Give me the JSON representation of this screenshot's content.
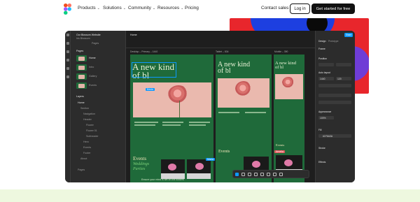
{
  "nav": {
    "links": [
      {
        "label": "Products",
        "has_menu": true
      },
      {
        "label": "Solutions",
        "has_menu": true
      },
      {
        "label": "Community",
        "has_menu": true
      },
      {
        "label": "Resources",
        "has_menu": true
      },
      {
        "label": "Pricing",
        "has_menu": false
      }
    ],
    "contact": "Contact sales",
    "login": "Log in",
    "cta": "Get started for free"
  },
  "editor": {
    "file_name": "Our Blossom Website",
    "team": "Iris Blossom",
    "pages_heading": "Pages",
    "pages": [
      "Home",
      "Intro",
      "Gallery",
      "Events",
      "Contact"
    ],
    "layers_heading": "Layers",
    "layers": [
      "Home",
      "Section",
      "Navigation",
      "Header",
      "Flower",
      "Flower 01",
      "Subheader",
      "Hero",
      "Events",
      "Footer",
      "About",
      "Pages"
    ],
    "canvas_tab": "Home",
    "frame_labels": [
      "Desktop – Primary – 1440",
      "Tablet – 834",
      "Mobile – 390"
    ],
    "headline": [
      "A new kind",
      "of bl"
    ],
    "events_title": "Events",
    "events_sub": [
      "Weddings",
      "Parties"
    ],
    "cursor_tags": [
      "Kevin",
      "Amelia",
      "Maria"
    ],
    "right_panel": {
      "share": "Share",
      "tabs": [
        "Design",
        "Prototype"
      ],
      "sections": [
        "Frame",
        "Position",
        "Auto layout",
        "Appearance",
        "Fill",
        "Stroke",
        "Effects"
      ],
      "values": [
        "1440",
        "120",
        "100%",
        "#1F6A3A"
      ]
    },
    "bottom_copy": "Ensure your mind is set on the flowers"
  },
  "colors": {
    "accent": "#0d99ff",
    "frame_green": "#1f6a3a",
    "cta_bg": "#111111",
    "hero_bottom": "#eef8df"
  }
}
